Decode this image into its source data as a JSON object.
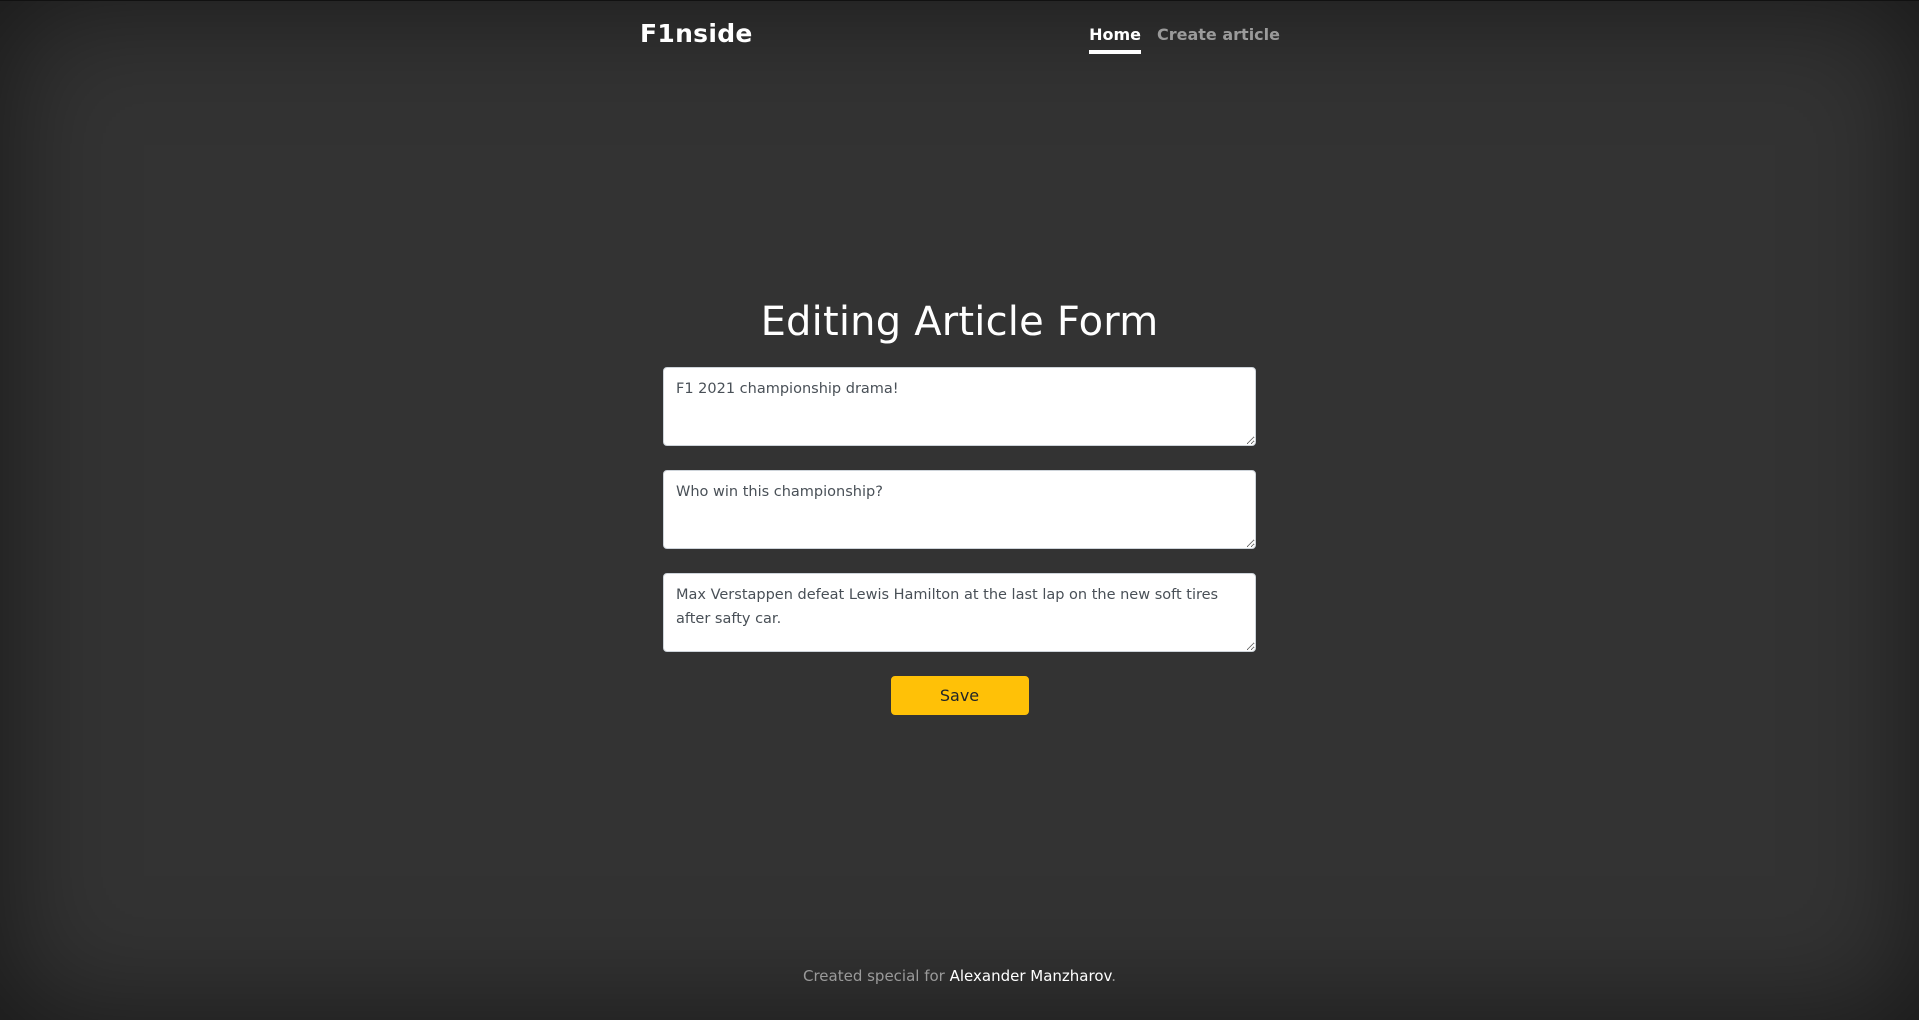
{
  "header": {
    "brand": "F1nside",
    "nav": [
      {
        "label": "Home",
        "active": true
      },
      {
        "label": "Create article",
        "active": false
      }
    ]
  },
  "main": {
    "title": "Editing Article Form",
    "fields": [
      {
        "value": "F1 2021 championship drama!"
      },
      {
        "value": "Who win this championship?"
      },
      {
        "value": "Max Verstappen defeat Lewis Hamilton at the last lap on the new soft tires after safty car."
      }
    ],
    "save_label": "Save"
  },
  "footer": {
    "prefix": "Created special for",
    "author": "Alexander Manzharov",
    "suffix": "."
  },
  "colors": {
    "background": "#333333",
    "accent": "#ffc107"
  }
}
